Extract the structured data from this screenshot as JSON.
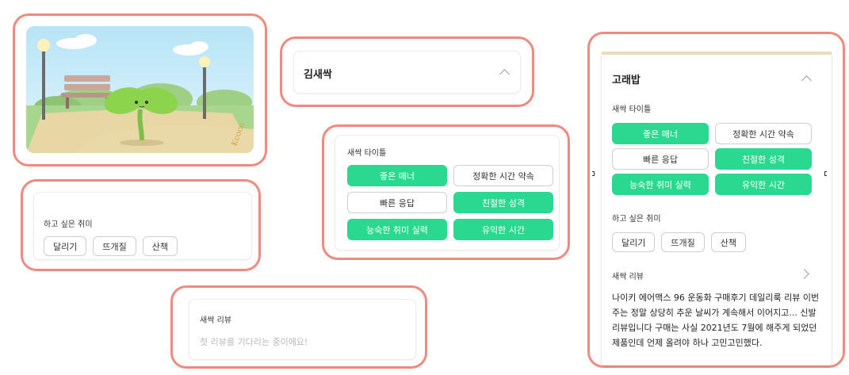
{
  "illustration": {
    "alt": "seedling character in park illustration",
    "signature": "Kcoco"
  },
  "profile_collapsed": {
    "name": "김새싹"
  },
  "titles_section": {
    "label": "새싹 타이틀",
    "chips": [
      {
        "label": "좋은 매너",
        "selected": true
      },
      {
        "label": "정확한 시간 약속",
        "selected": false
      },
      {
        "label": "빠른 응답",
        "selected": false
      },
      {
        "label": "친절한 성격",
        "selected": true
      },
      {
        "label": "능숙한 취미 실력",
        "selected": true
      },
      {
        "label": "유익한 시간",
        "selected": true
      }
    ]
  },
  "hobby_section": {
    "label": "하고 싶은 취미",
    "chips": [
      "달리기",
      "뜨개질",
      "산책"
    ]
  },
  "review_empty": {
    "label": "새싹 리뷰",
    "placeholder": "첫 리뷰를 기다리는 중이에요!"
  },
  "profile_expanded": {
    "name": "고래밥",
    "titles_label": "새싹 타이틀",
    "titles": [
      {
        "label": "좋은 매너",
        "selected": true
      },
      {
        "label": "정확한 시간 약속",
        "selected": false
      },
      {
        "label": "빠른 응답",
        "selected": false
      },
      {
        "label": "친절한 성격",
        "selected": true
      },
      {
        "label": "능숙한 취미 실력",
        "selected": true
      },
      {
        "label": "유익한 시간",
        "selected": true
      }
    ],
    "hobby_label": "하고 싶은 취미",
    "hobbies": [
      "달리기",
      "뜨개질",
      "산책"
    ],
    "review_label": "새싹 리뷰",
    "review_text": "나이키 에어맥스 96 운동화 구매후기 데일리룩 리뷰 이번주는 정말 상당히 추운 날씨가 계속해서 이어지고... 신발 리뷰입니다 구매는 사실 2021년도 7월에 해주게 되었던 제품인데 언제 올려야 하나 고민고민했다."
  },
  "colors": {
    "frame": "#f08a80",
    "chip_selected": "#2bd890",
    "chip_border": "#cfcfcf"
  }
}
